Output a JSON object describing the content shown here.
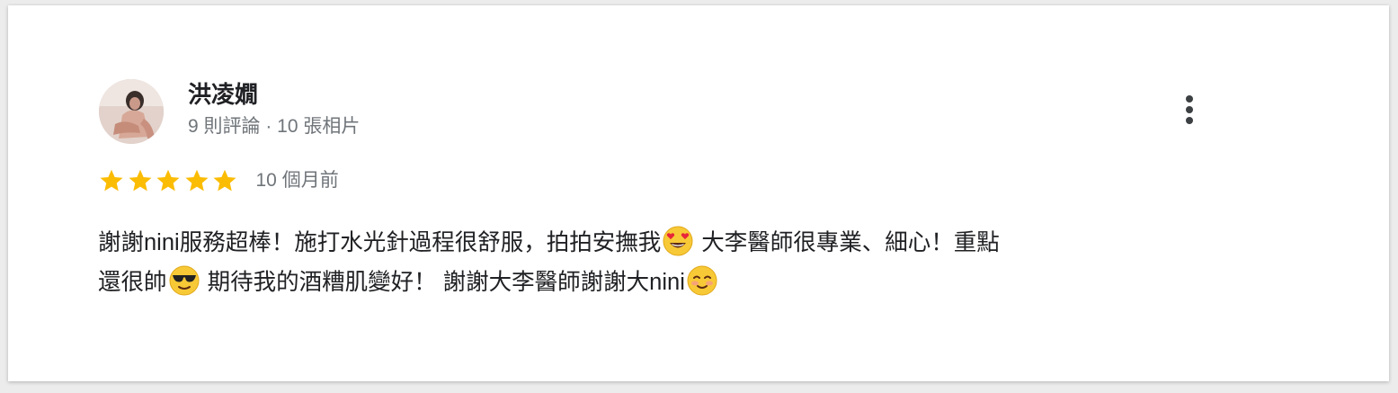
{
  "reviewer": {
    "name": "洪凌嫺",
    "meta": "9 則評論 · 10 張相片"
  },
  "rating": {
    "stars": 5,
    "max_stars": 5,
    "time_ago": "10 個月前"
  },
  "review": {
    "line1_part1": "謝謝nini服務超棒！施打水光針過程很舒服，拍拍安撫我",
    "line1_part2": " 大李醫師很專業、細心！重點",
    "line2_part1": "還很帥",
    "line2_part2": " 期待我的酒糟肌變好！ 謝謝大李醫師謝謝大nini",
    "emojis": [
      "heart-eyes-face",
      "sunglasses-face",
      "blushing-face"
    ]
  },
  "colors": {
    "star": "#fbbc04",
    "name": "#202124",
    "meta": "#70757a",
    "emoji_face": "#f8c936"
  },
  "icons": {
    "more_menu": "three-dots-vertical-icon",
    "star": "star-icon"
  }
}
